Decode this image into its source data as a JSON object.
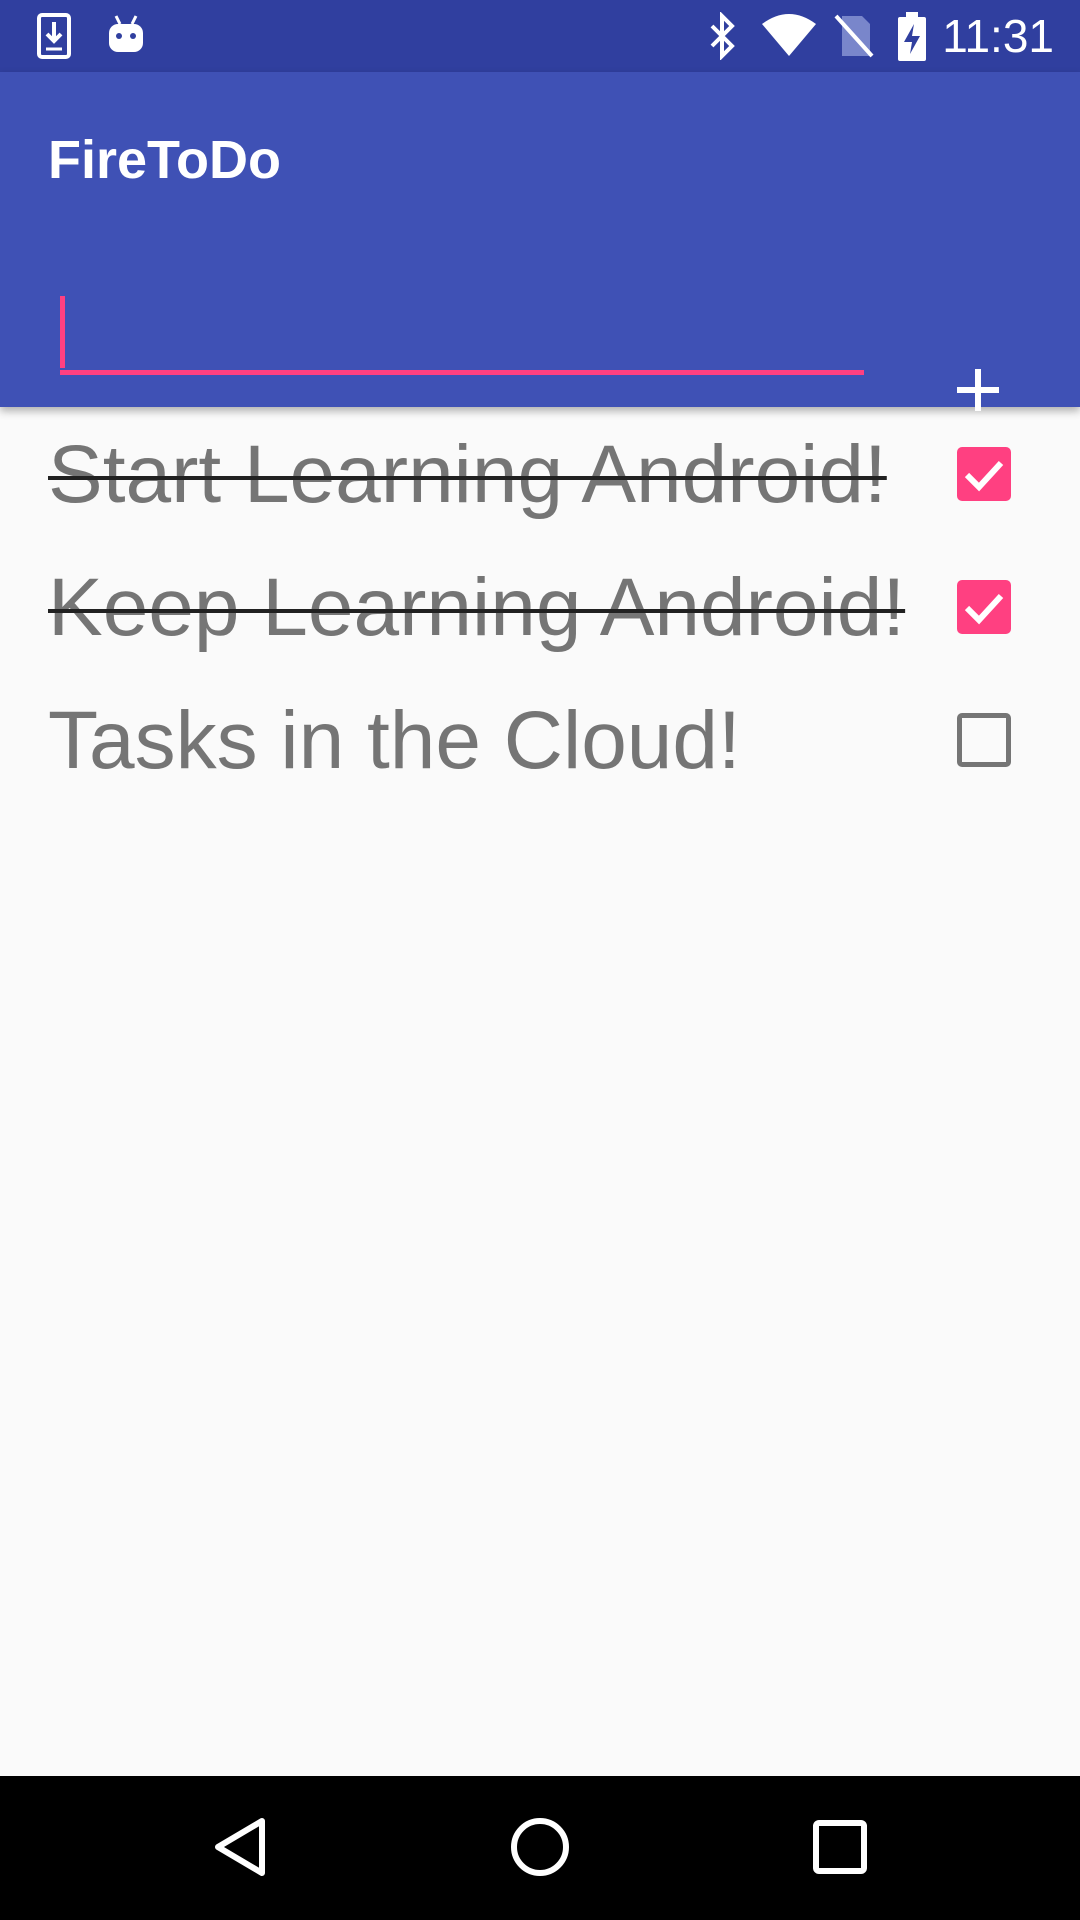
{
  "status_bar": {
    "time": "11:31",
    "icons": [
      "download-icon",
      "android-icon",
      "bluetooth-icon",
      "wifi-icon",
      "no-sim-icon",
      "battery-charging-icon"
    ]
  },
  "app_bar": {
    "title": "FireToDo",
    "input": {
      "value": "",
      "placeholder": ""
    },
    "add_button_icon": "plus-icon"
  },
  "tasks": [
    {
      "label": "Start Learning Android!",
      "checked": true
    },
    {
      "label": "Keep Learning Android!",
      "checked": true
    },
    {
      "label": "Tasks in the Cloud!",
      "checked": false
    }
  ],
  "nav_bar": {
    "icons": [
      "back-icon",
      "home-icon",
      "recents-icon"
    ]
  },
  "colors": {
    "primary": "#3f51b5",
    "primary_dark": "#303f9f",
    "accent": "#ff4081",
    "text_secondary": "#757575"
  }
}
